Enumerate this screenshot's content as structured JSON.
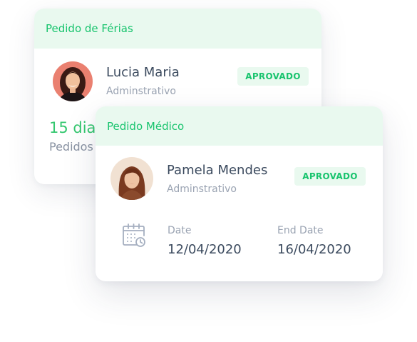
{
  "vacation_card": {
    "title": "Pedido de Férias",
    "employee": {
      "name": "Lucia Maria",
      "role": "Adminstrativo"
    },
    "status": "APROVADO",
    "days_value": "15 dias",
    "days_caption": "Pedidos"
  },
  "medical_card": {
    "title": "Pedido Médico",
    "employee": {
      "name": "Pamela Mendes",
      "role": "Adminstrativo"
    },
    "status": "APROVADO",
    "start_label": "Date",
    "start_value": "12/04/2020",
    "end_label": "End Date",
    "end_value": "16/04/2020",
    "icon": "calendar-clock-icon"
  },
  "colors": {
    "accent_green": "#19c46e",
    "header_bg": "#e9f9ef",
    "text_dark": "#3b4a5e",
    "text_muted": "#9aa3b2"
  }
}
